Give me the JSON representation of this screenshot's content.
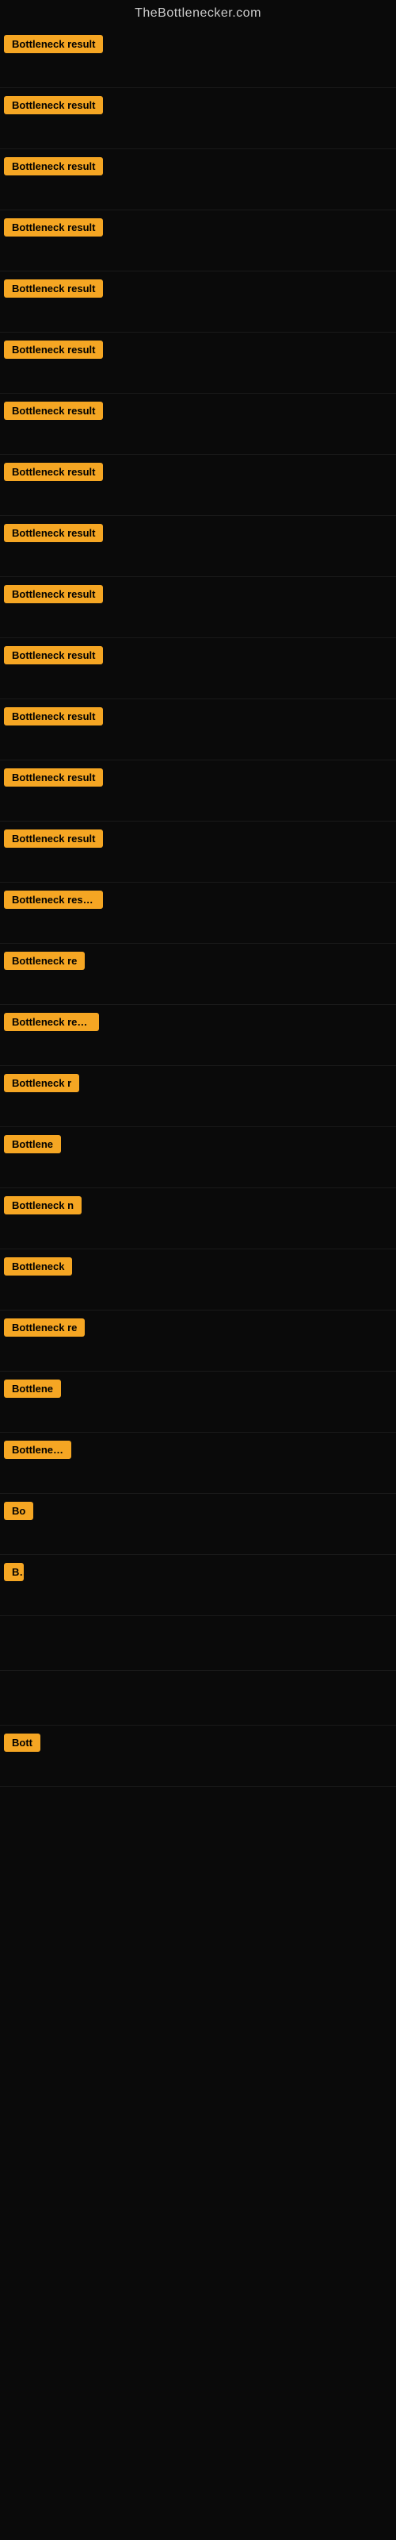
{
  "site": {
    "title": "TheBottlenecker.com"
  },
  "badge": {
    "label": "Bottleneck result",
    "color": "#f5a623"
  },
  "results": [
    {
      "id": 1,
      "text": "Bottleneck result"
    },
    {
      "id": 2,
      "text": "Bottleneck result"
    },
    {
      "id": 3,
      "text": "Bottleneck result"
    },
    {
      "id": 4,
      "text": "Bottleneck result"
    },
    {
      "id": 5,
      "text": "Bottleneck result"
    },
    {
      "id": 6,
      "text": "Bottleneck result"
    },
    {
      "id": 7,
      "text": "Bottleneck result"
    },
    {
      "id": 8,
      "text": "Bottleneck result"
    },
    {
      "id": 9,
      "text": "Bottleneck result"
    },
    {
      "id": 10,
      "text": "Bottleneck result"
    },
    {
      "id": 11,
      "text": "Bottleneck result"
    },
    {
      "id": 12,
      "text": "Bottleneck result"
    },
    {
      "id": 13,
      "text": "Bottleneck result"
    },
    {
      "id": 14,
      "text": "Bottleneck result"
    },
    {
      "id": 15,
      "text": "Bottleneck result"
    },
    {
      "id": 16,
      "text": "Bottleneck re"
    },
    {
      "id": 17,
      "text": "Bottleneck resul"
    },
    {
      "id": 18,
      "text": "Bottleneck r"
    },
    {
      "id": 19,
      "text": "Bottlene"
    },
    {
      "id": 20,
      "text": "Bottleneck n"
    },
    {
      "id": 21,
      "text": "Bottleneck"
    },
    {
      "id": 22,
      "text": "Bottleneck re"
    },
    {
      "id": 23,
      "text": "Bottlene"
    },
    {
      "id": 24,
      "text": "Bottleneck"
    },
    {
      "id": 25,
      "text": "Bo"
    },
    {
      "id": 26,
      "text": "B"
    },
    {
      "id": 27,
      "text": ""
    },
    {
      "id": 28,
      "text": ""
    },
    {
      "id": 29,
      "text": "Bott"
    }
  ]
}
